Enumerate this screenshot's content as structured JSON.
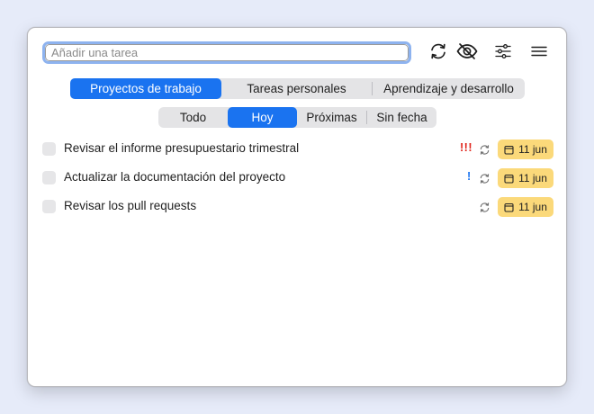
{
  "search": {
    "placeholder": "Añadir una tarea",
    "value": ""
  },
  "toolbar": {
    "icons": [
      "sync-icon",
      "hidden-eye-icon",
      "sliders-icon",
      "menu-icon"
    ]
  },
  "projects": {
    "tabs": [
      {
        "label": "Proyectos de trabajo",
        "selected": true
      },
      {
        "label": "Tareas personales",
        "selected": false
      },
      {
        "label": "Aprendizaje y desarrollo",
        "selected": false
      }
    ]
  },
  "filters": {
    "tabs": [
      {
        "label": "Todo",
        "selected": false
      },
      {
        "label": "Hoy",
        "selected": true
      },
      {
        "label": "Próximas",
        "selected": false
      },
      {
        "label": "Sin fecha",
        "selected": false
      }
    ]
  },
  "tasks": [
    {
      "title": "Revisar el informe presupuestario trimestral",
      "priority": "!!!",
      "priority_color": "#e0241b",
      "date": "11 jun",
      "checked": false
    },
    {
      "title": "Actualizar la documentación del proyecto",
      "priority": "!",
      "priority_color": "#1a73f0",
      "date": "11 jun",
      "checked": false
    },
    {
      "title": "Revisar los pull requests",
      "priority": "",
      "priority_color": "",
      "date": "11 jun",
      "checked": false
    }
  ],
  "colors": {
    "accent": "#1a73f0",
    "date_badge": "#fbd97a",
    "background": "#e6ebf9"
  }
}
